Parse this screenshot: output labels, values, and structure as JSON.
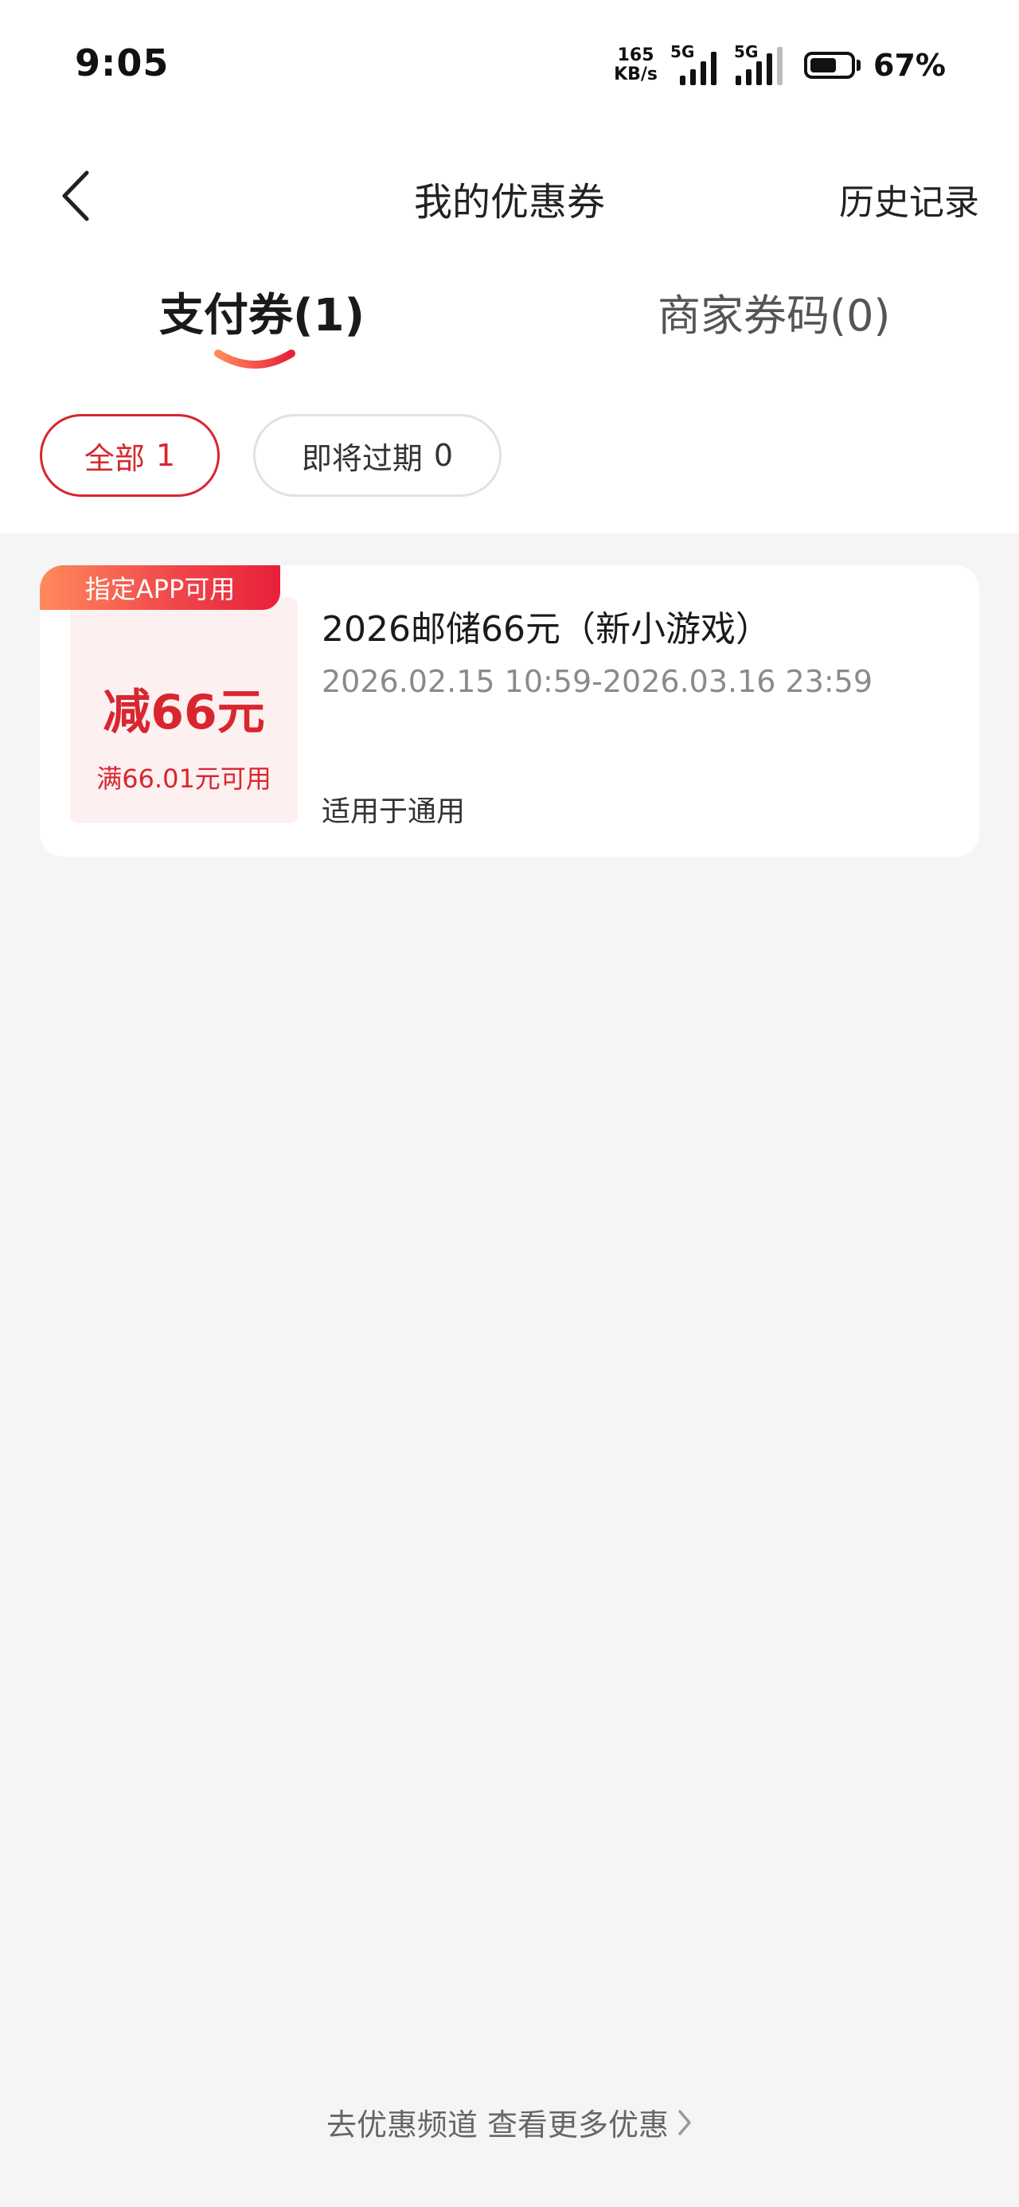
{
  "status_bar": {
    "time": "9:05",
    "net_speed_value": "165",
    "net_speed_unit": "KB/s",
    "signal_1_label": "5G",
    "signal_2_label": "5G",
    "battery_percent": "67%",
    "battery_level": 0.67
  },
  "header": {
    "title": "我的优惠券",
    "history_label": "历史记录"
  },
  "tabs": [
    {
      "label": "支付券(1)",
      "active": true
    },
    {
      "label": "商家券码(0)",
      "active": false
    }
  ],
  "filters": [
    {
      "label": "全部",
      "count": "1",
      "active": true
    },
    {
      "label": "即将过期",
      "count": "0",
      "active": false
    }
  ],
  "coupon": {
    "tag": "指定APP可用",
    "amount": "减66元",
    "condition": "满66.01元可用",
    "title": "2026邮储66元（新小游戏）",
    "validity": "2026.02.15 10:59-2026.03.16 23:59",
    "scope": "适用于通用"
  },
  "footer": {
    "link_label": "去优惠频道 查看更多优惠"
  },
  "colors": {
    "accent": "#d8262e",
    "page_bg": "#f5f5f5",
    "card_bg": "#ffffff",
    "coupon_left_bg": "#fdf0f0"
  }
}
